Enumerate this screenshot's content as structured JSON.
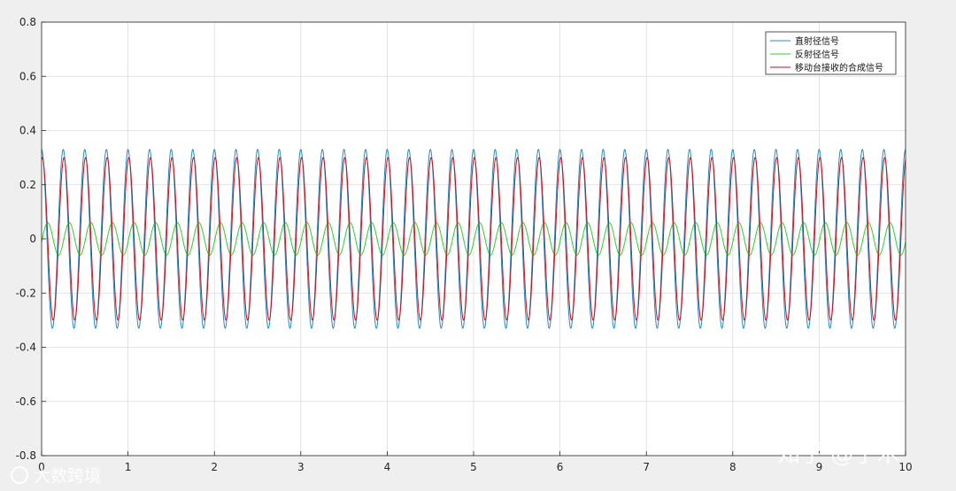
{
  "chart_data": {
    "type": "line",
    "title": "",
    "xlabel": "",
    "ylabel": "",
    "xlim": [
      0,
      10
    ],
    "ylim": [
      -0.8,
      0.8
    ],
    "x_ticks": [
      "0",
      "1",
      "2",
      "3",
      "4",
      "5",
      "6",
      "7",
      "8",
      "9",
      "10"
    ],
    "y_ticks": [
      "0.8",
      "0.6",
      "0.4",
      "0.2",
      "0",
      "-0.2",
      "-0.4",
      "-0.6",
      "-0.8"
    ],
    "grid": true,
    "legend_position": "top-right",
    "series": [
      {
        "name": "直射径信号",
        "color": "#2b8cbe",
        "amplitude": 0.33,
        "cycles_per_unit": 4,
        "phase": 1.5708
      },
      {
        "name": "反射径信号",
        "color": "#33cc33",
        "amplitude": 0.06,
        "cycles_per_unit": 4,
        "phase": -0.2
      },
      {
        "name": "移动台接收的合成信号",
        "color": "#c1121f",
        "amplitude": 0.3,
        "cycles_per_unit": 4,
        "phase": 1.35
      }
    ]
  },
  "watermarks": {
    "left": "大数跨境",
    "right": "知乎 @子木"
  }
}
